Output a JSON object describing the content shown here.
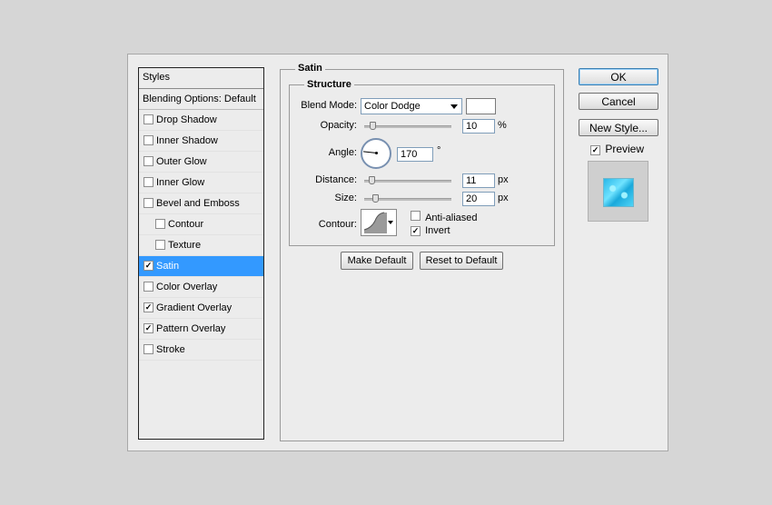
{
  "styles_panel": {
    "header": "Styles",
    "blending_options": "Blending Options: Default",
    "items": [
      {
        "label": "Drop Shadow",
        "checked": false
      },
      {
        "label": "Inner Shadow",
        "checked": false
      },
      {
        "label": "Outer Glow",
        "checked": false
      },
      {
        "label": "Inner Glow",
        "checked": false
      },
      {
        "label": "Bevel and Emboss",
        "checked": false
      },
      {
        "label": "Contour",
        "checked": false
      },
      {
        "label": "Texture",
        "checked": false
      },
      {
        "label": "Satin",
        "checked": true,
        "selected": true
      },
      {
        "label": "Color Overlay",
        "checked": false
      },
      {
        "label": "Gradient Overlay",
        "checked": true
      },
      {
        "label": "Pattern Overlay",
        "checked": true
      },
      {
        "label": "Stroke",
        "checked": false
      }
    ]
  },
  "satin": {
    "title": "Satin",
    "structure_title": "Structure",
    "blend_mode_label": "Blend Mode:",
    "blend_mode_value": "Color Dodge",
    "blend_color": "#ffffff",
    "opacity_label": "Opacity:",
    "opacity_value": "10",
    "opacity_unit": "%",
    "angle_label": "Angle:",
    "angle_value": "170",
    "angle_unit": "°",
    "distance_label": "Distance:",
    "distance_value": "11",
    "distance_unit": "px",
    "size_label": "Size:",
    "size_value": "20",
    "size_unit": "px",
    "contour_label": "Contour:",
    "anti_aliased_label": "Anti-aliased",
    "anti_aliased_checked": false,
    "invert_label": "Invert",
    "invert_checked": true,
    "make_default_label": "Make Default",
    "reset_default_label": "Reset to Default"
  },
  "actions": {
    "ok_label": "OK",
    "cancel_label": "Cancel",
    "new_style_label": "New Style...",
    "preview_label": "Preview",
    "preview_checked": true
  }
}
